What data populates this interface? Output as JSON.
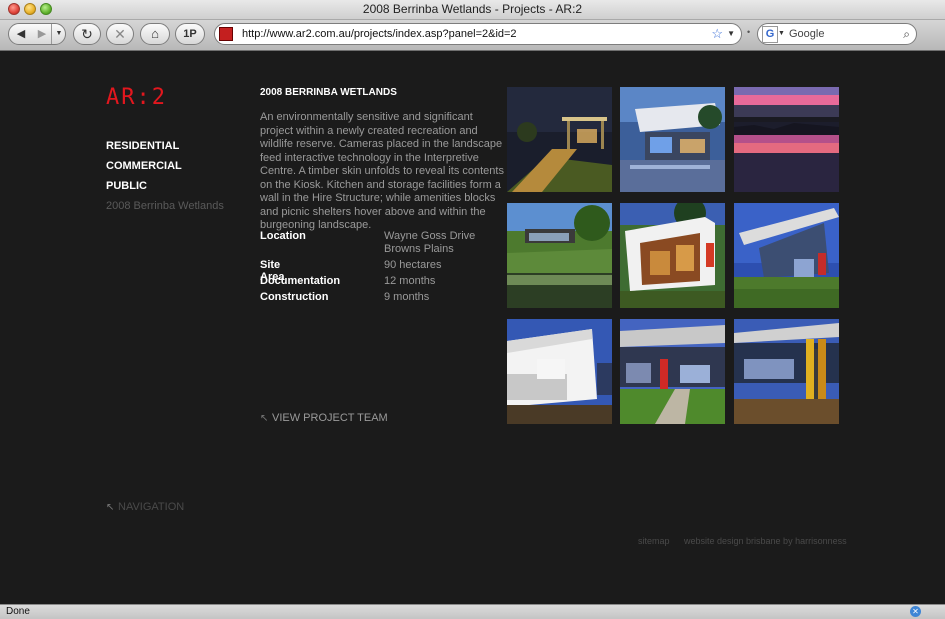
{
  "window": {
    "title": "2008 Berrinba Wetlands - Projects - AR:2"
  },
  "toolbar": {
    "back_glyph": "◀",
    "forward_glyph": "▶",
    "history_glyph": "▼",
    "reload_glyph": "↻",
    "stop_glyph": "✕",
    "home_glyph": "⌂",
    "onep_label": "1P",
    "url": "http://www.ar2.com.au/projects/index.asp?panel=2&id=2",
    "bookmark_glyph": "☆",
    "url_drop_glyph": "▼",
    "search_engine_glyph": "G",
    "search_placeholder": "Google",
    "search_glyph": "⌕"
  },
  "page": {
    "logo": "AR:2",
    "nav": [
      {
        "label": "RESIDENTIAL"
      },
      {
        "label": "COMMERCIAL"
      },
      {
        "label": "PUBLIC"
      },
      {
        "label": "2008 Berrinba Wetlands"
      }
    ],
    "project": {
      "title": "2008 BERRINBA WETLANDS",
      "description": "An environmentally sensitive and significant project within a newly created recreation and wildlife reserve. Cameras placed in the landscape feed interactive technology in the Interpretive Centre. A timber skin unfolds to reveal its contents on the Kiosk. Kitchen and storage facilities form a wall in the Hire Structure; while amenities blocks and picnic shelters hover above and within the burgeoning landscape.",
      "facts": [
        {
          "label": "Location",
          "value": "Wayne Goss Drive\nBrowns Plains"
        },
        {
          "label": "Site Area",
          "value": "90 hectares"
        },
        {
          "label": "Documentation",
          "value": "12 months"
        },
        {
          "label": "Construction",
          "value": "9 months"
        }
      ]
    },
    "team_link": "VIEW PROJECT TEAM",
    "nav_toggle": "NAVIGATION",
    "arrow_glyph": "↖",
    "footer": {
      "sitemap": "sitemap",
      "credit": "website design brisbane by harrisonness"
    }
  },
  "status": {
    "text": "Done"
  },
  "colors": {
    "logo_red": "#e2171e",
    "page_bg": "#1b1b1b",
    "text_grey": "#9a9a9a"
  }
}
